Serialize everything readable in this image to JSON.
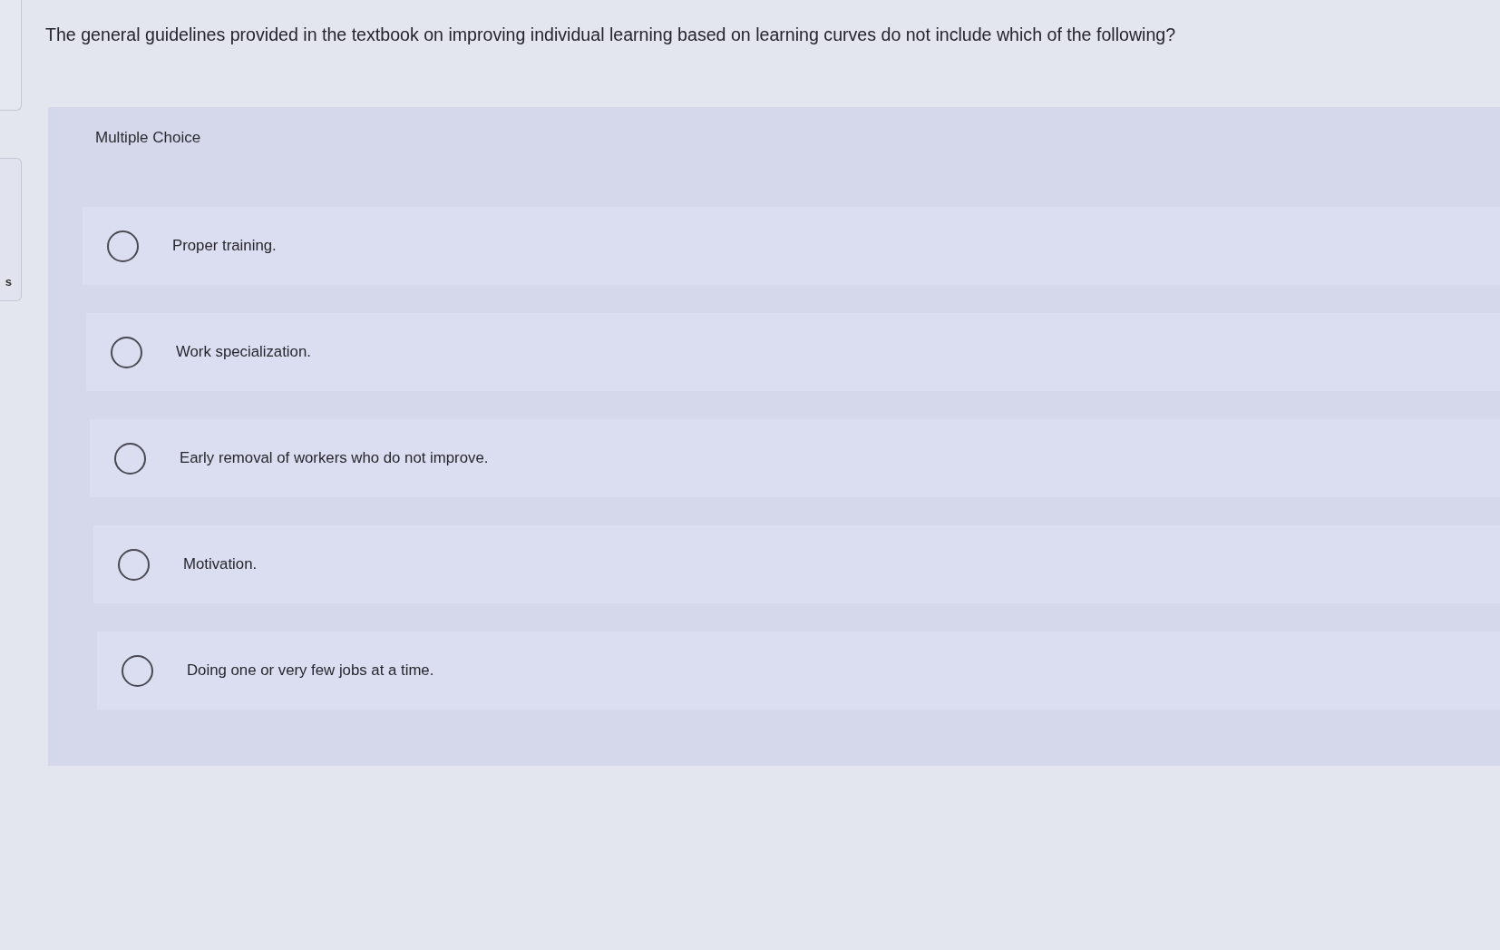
{
  "sidebar_fragment": {
    "label": "s"
  },
  "question": "The general guidelines provided in the textbook on improving individual learning based on learning curves do not include which of the following?",
  "answer_format": "Multiple Choice",
  "options": [
    {
      "label": "Proper training.",
      "selected": false
    },
    {
      "label": "Work specialization.",
      "selected": false
    },
    {
      "label": "Early removal of workers who do not improve.",
      "selected": false
    },
    {
      "label": "Motivation.",
      "selected": false
    },
    {
      "label": "Doing one or very few jobs at a time.",
      "selected": false
    }
  ]
}
